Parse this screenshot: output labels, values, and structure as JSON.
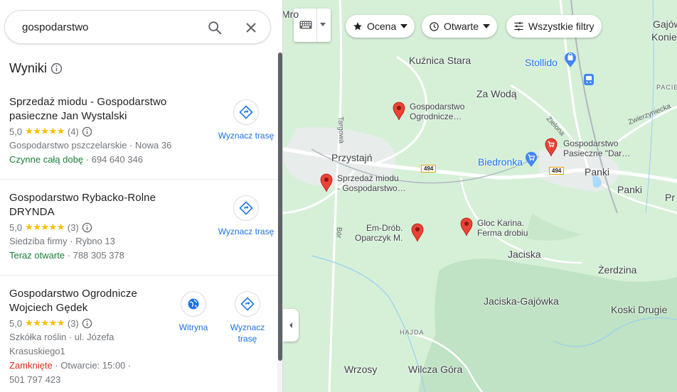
{
  "search": {
    "query": "gospodarstwo"
  },
  "results": {
    "heading": "Wyniki",
    "items": [
      {
        "title_line1": "Sprzedaż miodu - Gospodarstwo",
        "title_line2": "pasieczne Jan Wystalski",
        "rating": "5,0",
        "stars": "★★★★★",
        "reviews": "(4)",
        "info1": "Gospodarstwo pszczelarskie · Nowa 36",
        "status": "Czynne całą dobę",
        "phone": " · 694 640 346",
        "directions_label": "Wyznacz trasę"
      },
      {
        "title_line1": "Gospodarstwo Rybacko-Rolne",
        "title_line2": "DRYNDA",
        "rating": "5,0",
        "stars": "★★★★★",
        "reviews": "(3)",
        "info1": "Siedziba firmy · Rybno 13",
        "status": "Teraz otwarte",
        "phone": " · 788 305 378",
        "directions_label": "Wyznacz trasę"
      },
      {
        "title_line1": "Gospodarstwo Ogrodnicze",
        "title_line2": "Wojciech Gędek",
        "rating": "5,0",
        "stars": "★★★★★",
        "reviews": "(3)",
        "info1": "Szkółka roślin · ul. Józefa",
        "info2": "Krasuskiego1",
        "status": "Zamknięte",
        "hours": " · Otwarcie: 15:00 ·",
        "phone": "501 797 423",
        "website_label": "Witryna",
        "directions_label_1": "Wyznacz",
        "directions_label_2": "trasę"
      }
    ]
  },
  "filters": {
    "rating": "Ocena",
    "open": "Otwarte",
    "all": "Wszystkie filtry"
  },
  "map": {
    "places": {
      "mro": "Mro",
      "gaj1": "Gajów",
      "gaj2": "Konie",
      "kuznica": "Kuźnica Stara",
      "stollido": "Stollido",
      "pacie": "PACIE",
      "zawoda": "Za Wodą",
      "przystajn": "Przystajń",
      "biedronka": "Biedronka",
      "panki1": "Panki",
      "panki2": "Panki",
      "pr": "Pr",
      "jaciska": "Jaciska",
      "zerdzina": "Żerdzina",
      "jaciska_gaj": "Jaciska-Gajówka",
      "koski": "Koski Drugie",
      "hajda": "HAJDA",
      "wrzosy": "Wrzosy",
      "wilcza": "Wilcza Góra"
    },
    "roads": {
      "targowa": "Targowa",
      "zielona": "Zielona",
      "zwierzyniecka": "Zwierzyniecka",
      "bor": "Bór",
      "route1": "494",
      "route2": "494"
    },
    "pois": {
      "ogrodnicze_1": "Gospodarstwo",
      "ogrodnicze_2": "Ogrodnicze…",
      "pasieczne_1": "Gospodarstwo",
      "pasieczne_2": "Pasieczne \"Dar…",
      "miod_1": "Sprzedaż miodu",
      "miod_2": "- Gospodarstwo…",
      "emdrob_1": "Em-Drób.",
      "emdrob_2": "Oparczyk M.",
      "gloc_1": "Gloc Karina.",
      "gloc_2": "Ferma drobiu"
    }
  },
  "colors": {
    "accent": "#1a73e8",
    "open": "#188038",
    "closed": "#d93025",
    "star": "#fbbc04",
    "pin": "#ea4335",
    "map_green": "#d6f0d8"
  }
}
